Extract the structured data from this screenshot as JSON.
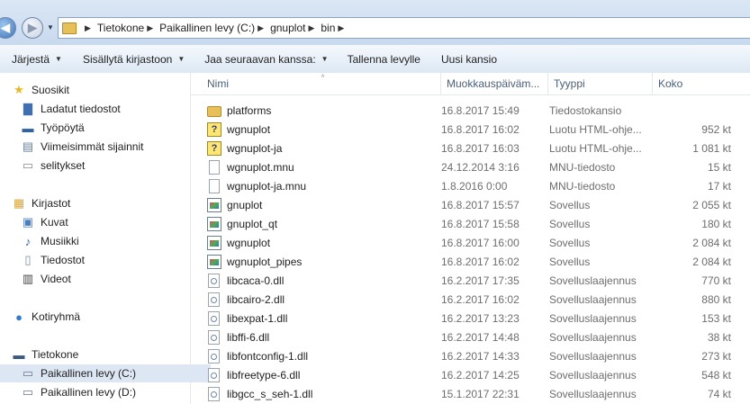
{
  "address": {
    "crumbs": [
      "Tietokone",
      "Paikallinen levy (C:)",
      "gnuplot",
      "bin"
    ]
  },
  "toolbar": {
    "items": [
      {
        "label": "Järjestä",
        "dropdown": true
      },
      {
        "label": "Sisällytä kirjastoon",
        "dropdown": true
      },
      {
        "label": "Jaa seuraavan kanssa:",
        "dropdown": true
      },
      {
        "label": "Tallenna levylle",
        "dropdown": false
      },
      {
        "label": "Uusi kansio",
        "dropdown": false
      }
    ]
  },
  "nav": {
    "items": [
      {
        "label": "Suosikit",
        "icon": "star-icon",
        "level": 0
      },
      {
        "label": "Ladatut tiedostot",
        "icon": "downloads-folder-icon",
        "level": 1
      },
      {
        "label": "Työpöytä",
        "icon": "desktop-icon",
        "level": 1
      },
      {
        "label": "Viimeisimmät sijainnit",
        "icon": "recent-places-icon",
        "level": 1
      },
      {
        "label": "selitykset",
        "icon": "folder-icon",
        "level": 1
      },
      {
        "label": "Kirjastot",
        "icon": "libraries-icon",
        "level": 0
      },
      {
        "label": "Kuvat",
        "icon": "pictures-icon",
        "level": 1
      },
      {
        "label": "Musiikki",
        "icon": "music-icon",
        "level": 1
      },
      {
        "label": "Tiedostot",
        "icon": "documents-icon",
        "level": 1
      },
      {
        "label": "Videot",
        "icon": "videos-icon",
        "level": 1
      },
      {
        "label": "Kotiryhmä",
        "icon": "homegroup-icon",
        "level": 0
      },
      {
        "label": "Tietokone",
        "icon": "computer-icon",
        "level": 0
      },
      {
        "label": "Paikallinen levy (C:)",
        "icon": "drive-c-icon",
        "level": 1,
        "selected": true
      },
      {
        "label": "Paikallinen levy (D:)",
        "icon": "drive-icon",
        "level": 1
      }
    ]
  },
  "columns": {
    "name": "Nimi",
    "date": "Muokkauspäiväm...",
    "type": "Tyyppi",
    "size": "Koko"
  },
  "files": [
    {
      "name": "platforms",
      "date": "16.8.2017 15:49",
      "type": "Tiedostokansio",
      "size": "",
      "icon": "folder"
    },
    {
      "name": "wgnuplot",
      "date": "16.8.2017 16:02",
      "type": "Luotu HTML-ohje...",
      "size": "952 kt",
      "icon": "help"
    },
    {
      "name": "wgnuplot-ja",
      "date": "16.8.2017 16:03",
      "type": "Luotu HTML-ohje...",
      "size": "1 081 kt",
      "icon": "help"
    },
    {
      "name": "wgnuplot.mnu",
      "date": "24.12.2014 3:16",
      "type": "MNU-tiedosto",
      "size": "15 kt",
      "icon": "doc"
    },
    {
      "name": "wgnuplot-ja.mnu",
      "date": "1.8.2016 0:00",
      "type": "MNU-tiedosto",
      "size": "17 kt",
      "icon": "doc"
    },
    {
      "name": "gnuplot",
      "date": "16.8.2017 15:57",
      "type": "Sovellus",
      "size": "2 055 kt",
      "icon": "app"
    },
    {
      "name": "gnuplot_qt",
      "date": "16.8.2017 15:58",
      "type": "Sovellus",
      "size": "180 kt",
      "icon": "app"
    },
    {
      "name": "wgnuplot",
      "date": "16.8.2017 16:00",
      "type": "Sovellus",
      "size": "2 084 kt",
      "icon": "app"
    },
    {
      "name": "wgnuplot_pipes",
      "date": "16.8.2017 16:02",
      "type": "Sovellus",
      "size": "2 084 kt",
      "icon": "app"
    },
    {
      "name": "libcaca-0.dll",
      "date": "16.2.2017 17:35",
      "type": "Sovelluslaajennus",
      "size": "770 kt",
      "icon": "dll"
    },
    {
      "name": "libcairo-2.dll",
      "date": "16.2.2017 16:02",
      "type": "Sovelluslaajennus",
      "size": "880 kt",
      "icon": "dll"
    },
    {
      "name": "libexpat-1.dll",
      "date": "16.2.2017 13:23",
      "type": "Sovelluslaajennus",
      "size": "153 kt",
      "icon": "dll"
    },
    {
      "name": "libffi-6.dll",
      "date": "16.2.2017 14:48",
      "type": "Sovelluslaajennus",
      "size": "38 kt",
      "icon": "dll"
    },
    {
      "name": "libfontconfig-1.dll",
      "date": "16.2.2017 14:33",
      "type": "Sovelluslaajennus",
      "size": "273 kt",
      "icon": "dll"
    },
    {
      "name": "libfreetype-6.dll",
      "date": "16.2.2017 14:25",
      "type": "Sovelluslaajennus",
      "size": "548 kt",
      "icon": "dll"
    },
    {
      "name": "libgcc_s_seh-1.dll",
      "date": "15.1.2017 22:31",
      "type": "Sovelluslaajennus",
      "size": "74 kt",
      "icon": "dll"
    }
  ]
}
